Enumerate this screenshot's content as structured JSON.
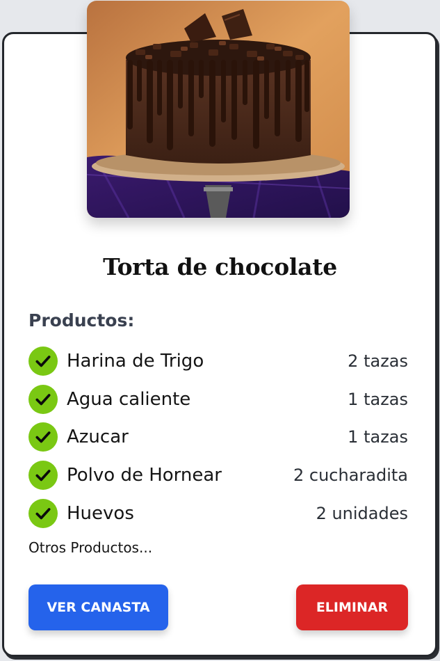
{
  "recipe": {
    "title": "Torta de chocolate",
    "image_alt": "chocolate-drip-cake-photo"
  },
  "products": {
    "label": "Productos:",
    "items": [
      {
        "name": "Harina de Trigo",
        "qty": "2 tazas"
      },
      {
        "name": "Agua caliente",
        "qty": "1 tazas"
      },
      {
        "name": "Azucar",
        "qty": "1 tazas"
      },
      {
        "name": "Polvo de Hornear",
        "qty": "2 cucharadita"
      },
      {
        "name": "Huevos",
        "qty": "2 unidades"
      }
    ],
    "more": "Otros Productos..."
  },
  "actions": {
    "basket_label": "VER CANASTA",
    "delete_label": "ELIMINAR"
  },
  "colors": {
    "check": "#7ac813",
    "primary": "#2563eb",
    "danger": "#dc2626"
  },
  "icons": {
    "check": "check-icon"
  }
}
